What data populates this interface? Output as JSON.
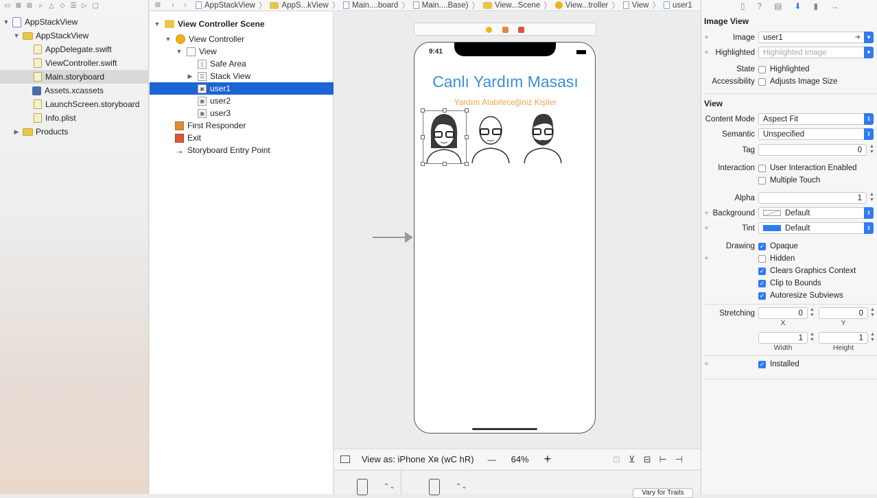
{
  "navigator": {
    "items": [
      {
        "label": "AppStackView",
        "type": "project",
        "level": 0,
        "expanded": true
      },
      {
        "label": "AppStackView",
        "type": "folder",
        "level": 1,
        "expanded": true
      },
      {
        "label": "AppDelegate.swift",
        "type": "file",
        "level": 2
      },
      {
        "label": "ViewController.swift",
        "type": "file",
        "level": 2
      },
      {
        "label": "Main.storyboard",
        "type": "file",
        "level": 2,
        "selected": true
      },
      {
        "label": "Assets.xcassets",
        "type": "asset",
        "level": 2
      },
      {
        "label": "LaunchScreen.storyboard",
        "type": "file",
        "level": 2
      },
      {
        "label": "Info.plist",
        "type": "file",
        "level": 2
      },
      {
        "label": "Products",
        "type": "folder",
        "level": 1,
        "expanded": false
      }
    ]
  },
  "breadcrumb": [
    "AppStackView",
    "AppS...kView",
    "Main....board",
    "Main....Base)",
    "View...Scene",
    "View...troller",
    "View",
    "user1"
  ],
  "outline": {
    "items": [
      {
        "label": "View Controller Scene",
        "level": 0
      },
      {
        "label": "View Controller",
        "level": 1
      },
      {
        "label": "View",
        "level": 2
      },
      {
        "label": "Safe Area",
        "level": 3
      },
      {
        "label": "Stack View",
        "level": 3
      },
      {
        "label": "user1",
        "level": 3,
        "selected": true
      },
      {
        "label": "user2",
        "level": 3
      },
      {
        "label": "user3",
        "level": 3
      },
      {
        "label": "First Responder",
        "level": 1
      },
      {
        "label": "Exit",
        "level": 1
      },
      {
        "label": "Storyboard Entry Point",
        "level": 1
      }
    ]
  },
  "phone": {
    "time": "9:41",
    "title": "Canlı Yardım Masası",
    "subtitle": "Yardım Alabileceğiniz Kişiler"
  },
  "bottombar": {
    "view_as": "View as: iPhone Xʀ (wC hR)",
    "zoom": "64%",
    "minus": "—",
    "plus": "+"
  },
  "devbar": {
    "vary": "Vary for Traits"
  },
  "inspector": {
    "section_image": "Image View",
    "image_label": "Image",
    "image_value": "user1",
    "highlighted_label": "Highlighted",
    "highlighted_placeholder": "Highlighted Image",
    "state_label": "State",
    "state_value": "Highlighted",
    "accessibility_label": "Accessibility",
    "accessibility_value": "Adjusts Image Size",
    "section_view": "View",
    "content_mode_label": "Content Mode",
    "content_mode_value": "Aspect Fit",
    "semantic_label": "Semantic",
    "semantic_value": "Unspecified",
    "tag_label": "Tag",
    "tag_value": "0",
    "interaction_label": "Interaction",
    "user_interaction": "User Interaction Enabled",
    "multiple_touch": "Multiple Touch",
    "alpha_label": "Alpha",
    "alpha_value": "1",
    "background_label": "Background",
    "background_value": "Default",
    "tint_label": "Tint",
    "tint_value": "Default",
    "drawing_label": "Drawing",
    "opaque": "Opaque",
    "hidden": "Hidden",
    "clears": "Clears Graphics Context",
    "clip": "Clip to Bounds",
    "autoresize": "Autoresize Subviews",
    "stretching_label": "Stretching",
    "stretch_x": "0",
    "stretch_y": "0",
    "x_label": "X",
    "y_label": "Y",
    "stretch_w": "1",
    "stretch_h": "1",
    "width_label": "Width",
    "height_label": "Height",
    "installed": "Installed"
  },
  "colors": {
    "accent": "#1d64d4",
    "title": "#3a8fd6",
    "subtitle": "#f0a34a",
    "tint": "#2f7bf0"
  }
}
